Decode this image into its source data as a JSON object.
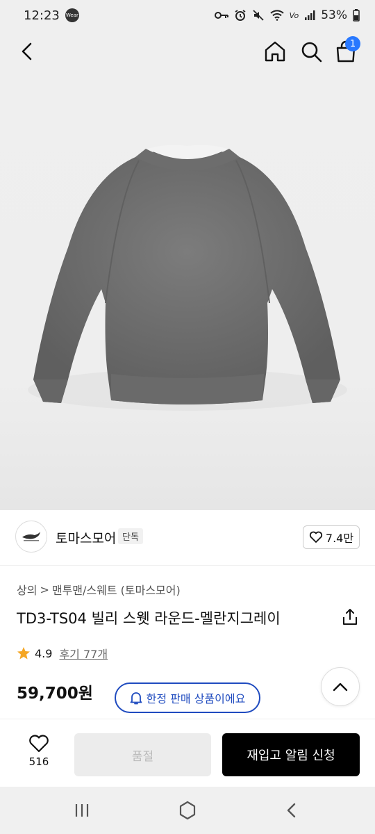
{
  "status_bar": {
    "time": "12:23",
    "wear_label": "Wear",
    "battery": "53%"
  },
  "header": {
    "cart_count": "1"
  },
  "brand": {
    "name": "토마스모어",
    "tag": "단독",
    "likes": "7.4만"
  },
  "breadcrumb": {
    "level1": "상의",
    "separator": ">",
    "level2": "맨투맨/스웨트 (토마스모어)"
  },
  "product": {
    "title": "TD3-TS04 빌리 스웻 라운드-멜란지그레이",
    "rating": "4.9",
    "review_label": "후기 77개",
    "price": "59,700원",
    "limited_label": "한정 판매 상품이에요"
  },
  "bottom": {
    "wish_count": "516",
    "soldout_label": "품절",
    "restock_label": "재입고 알림 신청"
  },
  "colors": {
    "accent_blue": "#1f4bbf",
    "badge_blue": "#2878ff",
    "star": "#f5a623"
  }
}
